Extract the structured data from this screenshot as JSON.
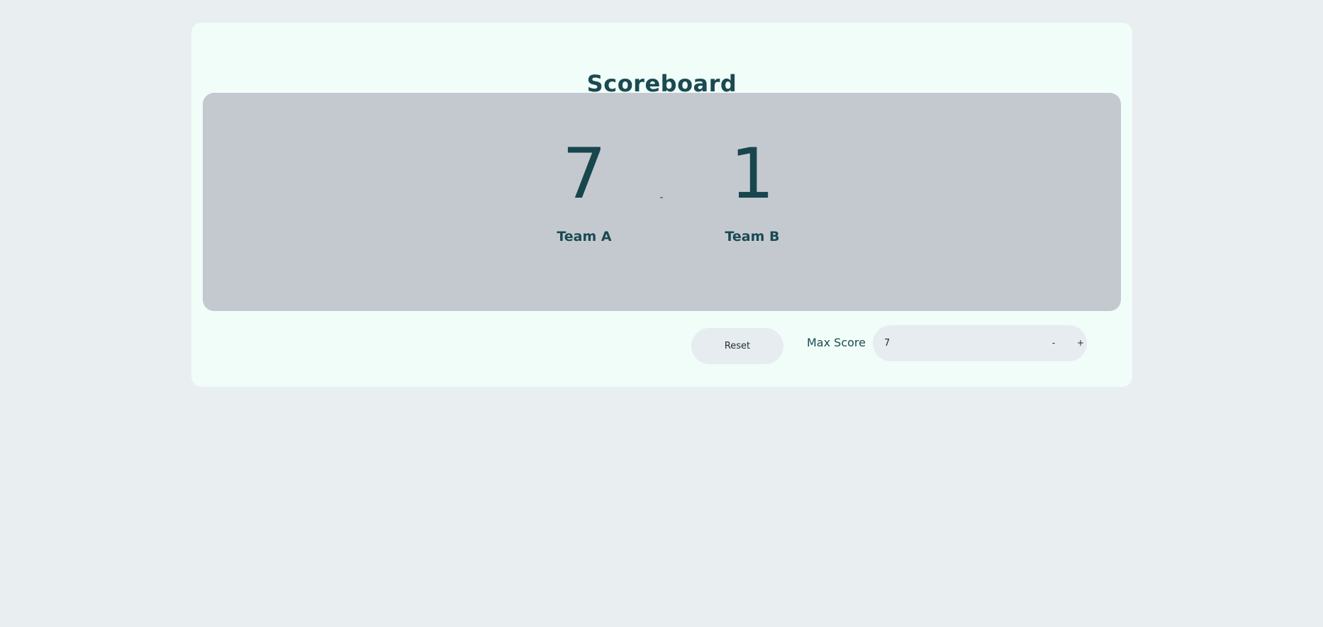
{
  "title": "Scoreboard",
  "teams": [
    {
      "name": "Team A",
      "score": "7"
    },
    {
      "name": "Team B",
      "score": "1"
    }
  ],
  "separator": "-",
  "controls": {
    "reset_label": "Reset",
    "max_score_label": "Max Score",
    "max_score_value": "7",
    "decrement_label": "-",
    "increment_label": "+"
  },
  "colors": {
    "background": "#e9eef1",
    "card": "#f1fdf8",
    "panel": "#c4c9d0",
    "text": "#1a4a52",
    "control": "#e6ecef"
  }
}
